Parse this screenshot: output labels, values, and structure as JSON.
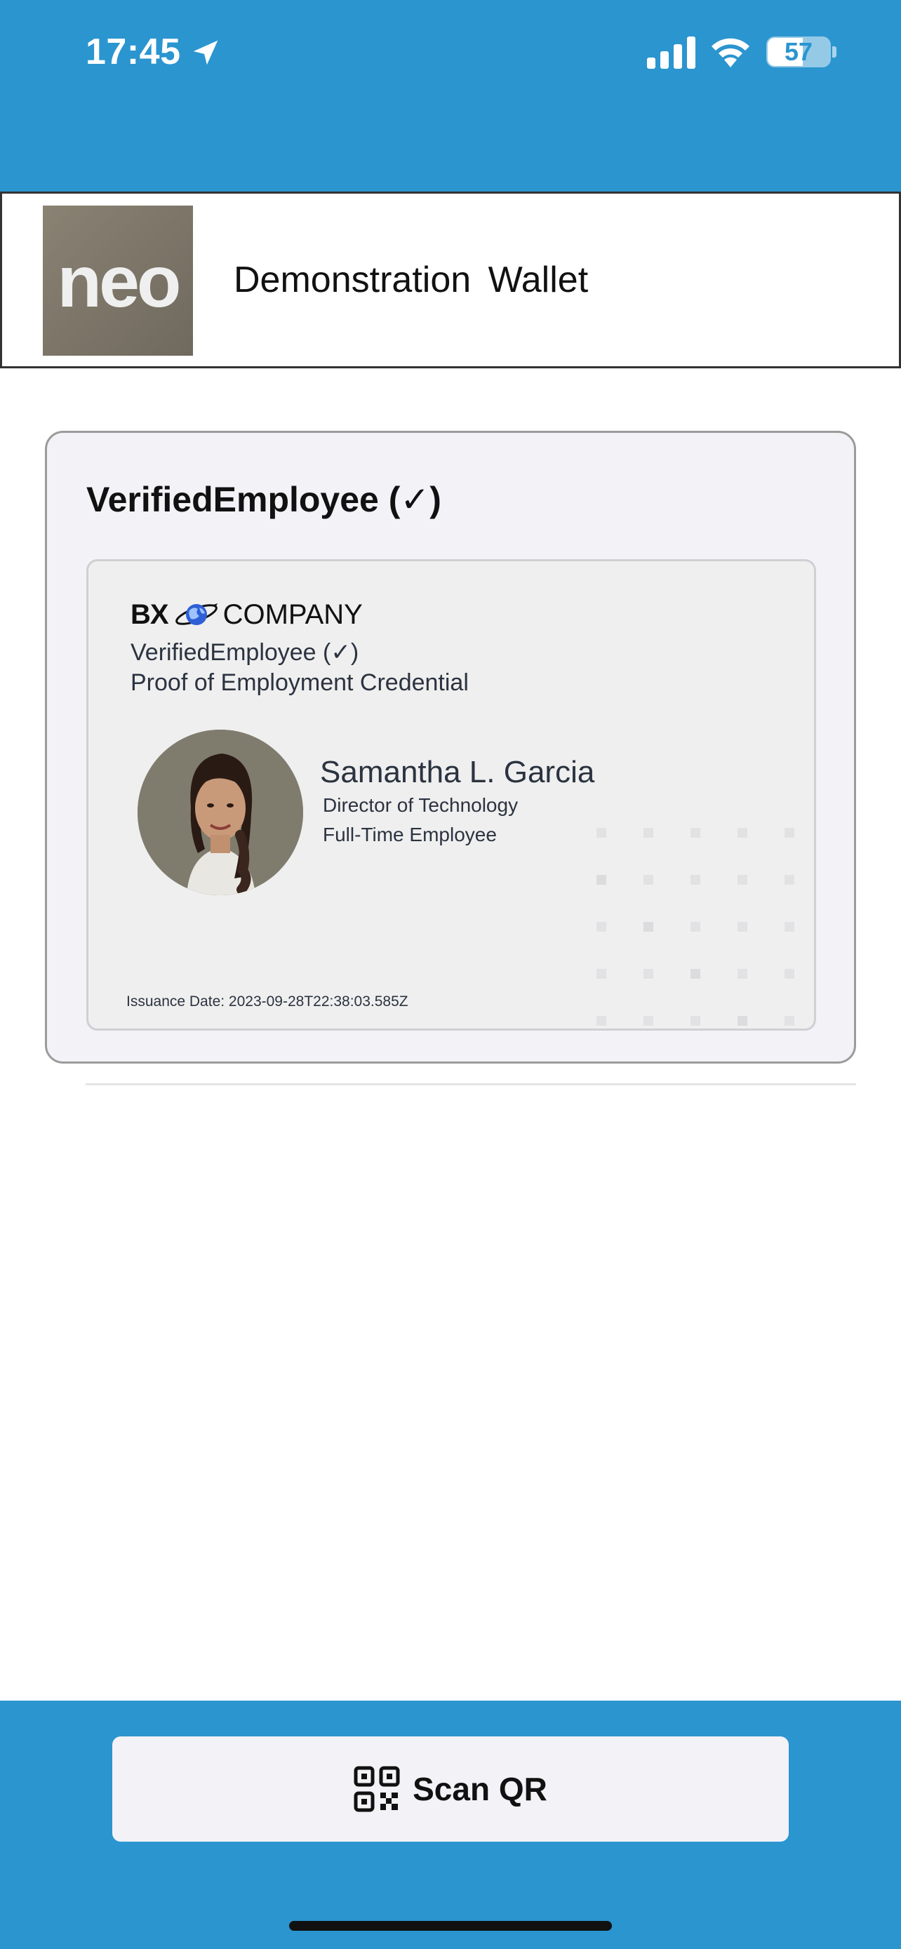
{
  "status_bar": {
    "time": "17:45",
    "battery": "57",
    "icons": [
      "location-arrow-icon",
      "cellular-signal-icon",
      "wifi-icon",
      "battery-icon"
    ]
  },
  "header": {
    "logo_text": "neo",
    "title": "Demonstration  Wallet"
  },
  "credential_card": {
    "title": "VerifiedEmployee (✓)",
    "company_prefix": "BX",
    "company_name": "COMPANY",
    "credential_type": "VerifiedEmployee (✓)",
    "credential_description": "Proof of Employment Credential",
    "holder_name": "Samantha L. Garcia",
    "holder_role": "Director of Technology",
    "holder_status": "Full-Time Employee",
    "issuance_date": "Issuance Date: 2023-09-28T22:38:03.585Z"
  },
  "bottom": {
    "scan_label": "Scan QR",
    "scan_icon": "qr-code-icon"
  },
  "colors": {
    "brand_blue": "#2b95cf",
    "card_bg": "#f2f2f7",
    "text_dark": "#2b3340"
  }
}
